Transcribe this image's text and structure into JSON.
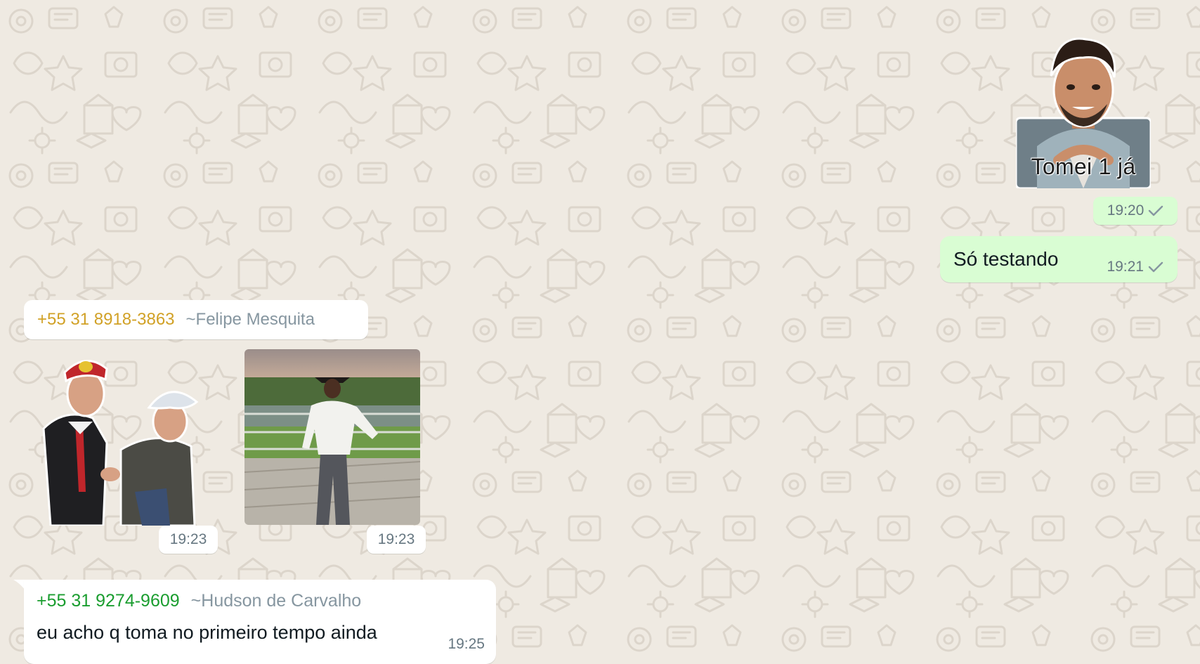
{
  "chat": {
    "outgoing": [
      {
        "type": "sticker",
        "caption": "Tomei 1 já",
        "time": "19:20",
        "status": "sent",
        "status_icon": "check-icon"
      },
      {
        "type": "text",
        "text": "Só testando",
        "time": "19:21",
        "status": "sent",
        "status_icon": "check-icon"
      }
    ],
    "incoming": [
      {
        "phone": "+55 31 8918-3863",
        "alias": "~Felipe Mesquita",
        "phone_color": "#d1a126",
        "media": [
          {
            "type": "sticker",
            "time": "19:23"
          },
          {
            "type": "video",
            "time": "19:23"
          }
        ]
      },
      {
        "phone": "+55 31 9274-9609",
        "alias": "~Hudson de Carvalho",
        "phone_color": "#1a9d2f",
        "text": "eu acho q toma no primeiro tempo ainda",
        "time": "19:25"
      }
    ]
  },
  "colors": {
    "wallpaper": "#efeae2",
    "outgoing_bubble": "#d9fdd3",
    "incoming_bubble": "#ffffff",
    "meta_text": "#667781"
  }
}
